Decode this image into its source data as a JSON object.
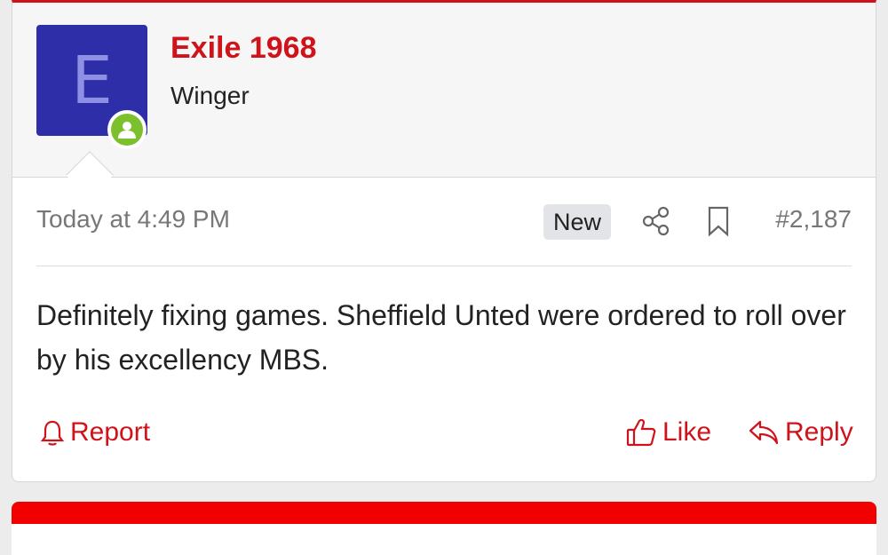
{
  "colors": {
    "accent": "#d0121b",
    "avatar_bg": "#2e2ea8",
    "avatar_letter": "#8f8fe6",
    "online": "#7cc12d",
    "next_post_bar": "#f20000"
  },
  "user": {
    "avatar_letter": "E",
    "name": "Exile 1968",
    "title": "Winger",
    "online_icon": "online-user-icon"
  },
  "post": {
    "date": "Today at 4:49 PM",
    "badge": "New",
    "share_icon": "share-icon",
    "bookmark_icon": "bookmark-icon",
    "number": "#2,187",
    "message": "Definitely fixing games. Sheffield Unted were ordered to roll over by his excellency MBS."
  },
  "actions": {
    "report_label": "Report",
    "like_label": "Like",
    "reply_label": "Reply"
  }
}
